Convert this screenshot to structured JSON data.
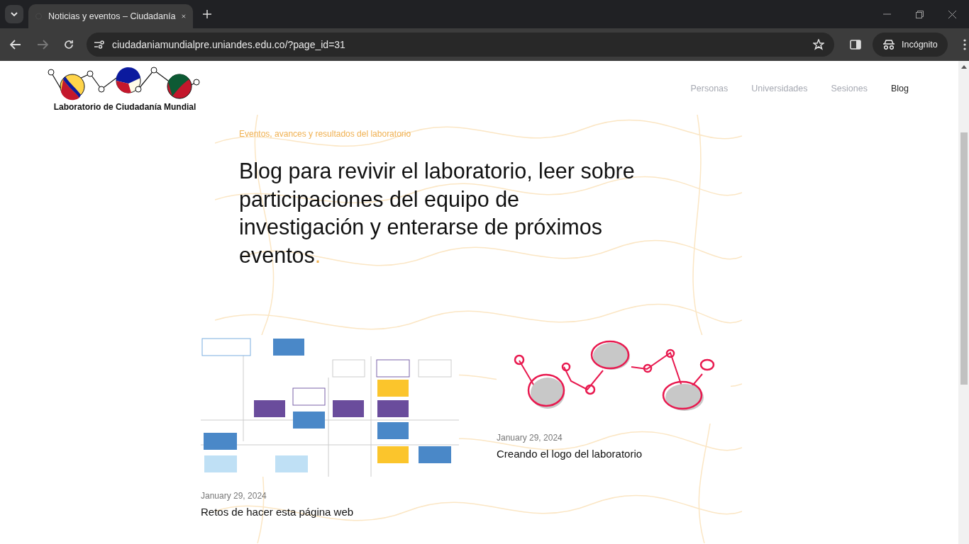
{
  "browser": {
    "tab_title": "Noticias y eventos – Ciudadanía",
    "url": "ciudadaniamundialpre.uniandes.edu.co/?page_id=31",
    "profile": "Incógnito"
  },
  "site": {
    "logo_text": "Laboratorio de Ciudadanía Mundial",
    "nav": [
      {
        "label": "Personas",
        "selected": false
      },
      {
        "label": "Universidades",
        "selected": false
      },
      {
        "label": "Sesiones",
        "selected": false
      },
      {
        "label": "Blog",
        "selected": true
      }
    ]
  },
  "hero": {
    "eyebrow": "Eventos, avances y resultados del laboratorio",
    "heading": "Blog para revivir el laboratorio, leer sobre participaciones del equipo de investigación y enterarse de próximos eventos",
    "heading_end": "."
  },
  "posts": [
    {
      "date": "January 29, 2024",
      "title": "Retos de hacer esta página web"
    },
    {
      "date": "January 29, 2024",
      "title": "Creando el logo del laboratorio"
    }
  ]
}
